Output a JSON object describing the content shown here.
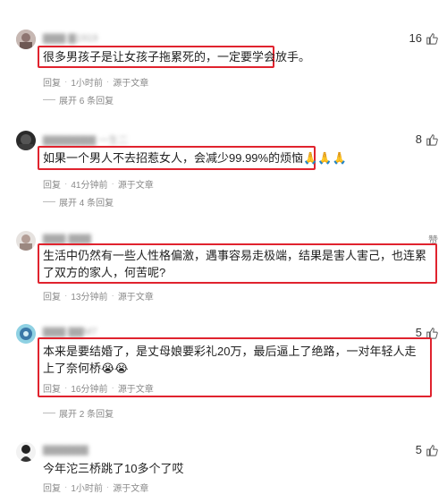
{
  "reply_label": "回复",
  "source_label": "源于文章",
  "comments": [
    {
      "likes": "16",
      "text": "很多男孩子是让女孩子拖累死的，一定要学会放手。",
      "time": "1小时前",
      "expand": "展开 6 条回复"
    },
    {
      "likes": "8",
      "text": "如果一个男人不去招惹女人，会减少99.99%的烦恼🙏🙏🙏",
      "time": "41分钟前",
      "expand": "展开 4 条回复"
    },
    {
      "likes": "赞",
      "text": "生活中仍然有一些人性格偏激，遇事容易走极端，结果是害人害己，也连累了双方的家人，何苦呢?",
      "time": "13分钟前"
    },
    {
      "likes": "5",
      "text": "本来是要结婚了，是丈母娘要彩礼20万，最后逼上了绝路，一对年轻人走上了奈何桥😭😭",
      "time": "16分钟前",
      "expand": "展开 2 条回复"
    },
    {
      "likes": "5",
      "text": "今年沱三桥跳了10多个了哎",
      "time": "1小时前"
    }
  ]
}
